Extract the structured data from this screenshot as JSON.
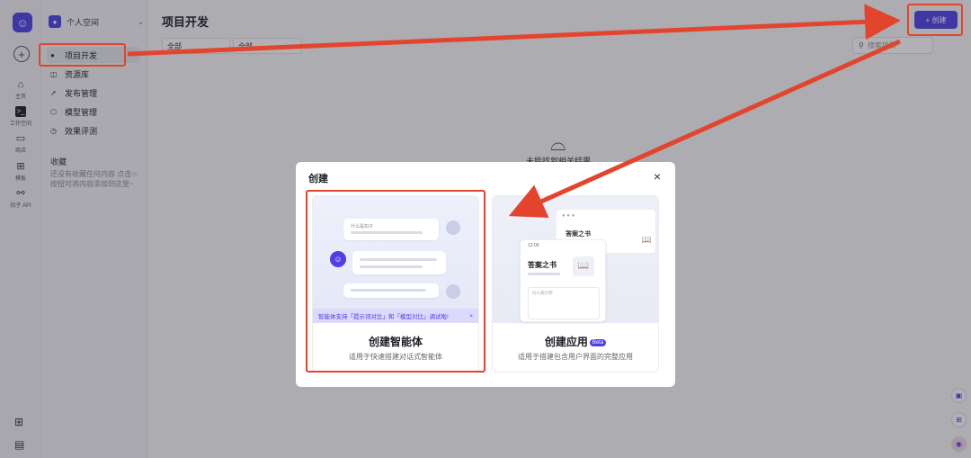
{
  "rail": {
    "items": [
      {
        "label": "主页",
        "icon": "home-icon"
      },
      {
        "label": "工作空间",
        "icon": "terminal-icon"
      },
      {
        "label": "商店",
        "icon": "store-icon"
      },
      {
        "label": "模板",
        "icon": "template-icon"
      },
      {
        "label": "扣子 API",
        "icon": "api-icon"
      }
    ]
  },
  "sidebar": {
    "space_name": "个人空间",
    "items": [
      {
        "label": "项目开发",
        "icon": "bot-icon"
      },
      {
        "label": "资源库",
        "icon": "library-icon"
      },
      {
        "label": "发布管理",
        "icon": "rocket-icon"
      },
      {
        "label": "模型管理",
        "icon": "cube-icon"
      },
      {
        "label": "效果评测",
        "icon": "gauge-icon"
      }
    ],
    "favorites_title": "收藏",
    "favorites_tip": "还没有收藏任何内容 点击☆按钮可将内容添加到这里~"
  },
  "main": {
    "title": "项目开发",
    "filter_1": "全部",
    "filter_2": "全部",
    "search_placeholder": "搜索项目",
    "create_label": "+ 创建",
    "empty_text": "未能找到相关结果"
  },
  "modal": {
    "title": "创建",
    "close": "×",
    "agent": {
      "title": "创建智能体",
      "desc": "适用于快速搭建对话式智能体",
      "question": "什么是扣子",
      "tip": "智能体支持「提示词对比」和「模型对比」调试啦!",
      "tip_close": "×"
    },
    "app": {
      "title": "创建应用",
      "badge": "Beta",
      "desc": "适用于搭建包含用户界面的完整应用",
      "book_title": "答案之书",
      "time": "12:00",
      "input_placeholder": "问么我们吧"
    }
  }
}
